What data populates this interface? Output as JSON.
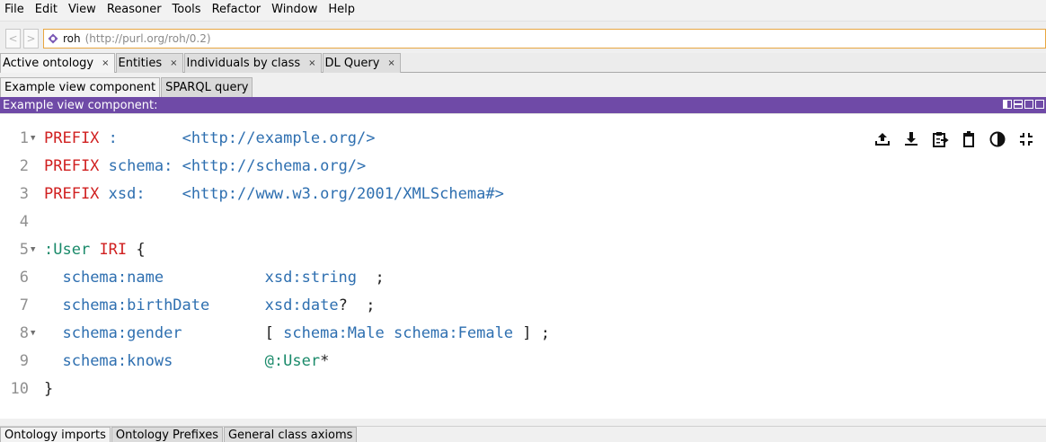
{
  "menu": [
    "File",
    "Edit",
    "View",
    "Reasoner",
    "Tools",
    "Refactor",
    "Window",
    "Help"
  ],
  "nav": {
    "back": "<",
    "forward": ">"
  },
  "iri_bar": {
    "name": "roh",
    "url": "(http://purl.org/roh/0.2)"
  },
  "tabs": [
    {
      "label": "Active ontology",
      "close": "×"
    },
    {
      "label": "Entities",
      "close": "×"
    },
    {
      "label": "Individuals by class",
      "close": "×"
    },
    {
      "label": "DL Query",
      "close": "×"
    }
  ],
  "subtabs": [
    "Example view component",
    "SPARQL query"
  ],
  "view_header": {
    "title": "Example view component:"
  },
  "editor": {
    "lines": [
      {
        "n": "1",
        "fold": "▼",
        "tokens": [
          [
            "kw",
            "PREFIX"
          ],
          [
            "op",
            " "
          ],
          [
            "pfx",
            ":"
          ],
          [
            "op",
            "       "
          ],
          [
            "iri",
            "<http://example.org/>"
          ]
        ]
      },
      {
        "n": "2",
        "fold": "",
        "tokens": [
          [
            "kw",
            "PREFIX"
          ],
          [
            "op",
            " "
          ],
          [
            "pfx",
            "schema:"
          ],
          [
            "op",
            " "
          ],
          [
            "iri",
            "<http://schema.org/>"
          ]
        ]
      },
      {
        "n": "3",
        "fold": "",
        "tokens": [
          [
            "kw",
            "PREFIX"
          ],
          [
            "op",
            " "
          ],
          [
            "pfx",
            "xsd:"
          ],
          [
            "op",
            "    "
          ],
          [
            "iri",
            "<http://www.w3.org/2001/XMLSchema#>"
          ]
        ]
      },
      {
        "n": "4",
        "fold": "",
        "tokens": []
      },
      {
        "n": "5",
        "fold": "▼",
        "tokens": [
          [
            "shape",
            ":User"
          ],
          [
            "op",
            " "
          ],
          [
            "kw",
            "IRI"
          ],
          [
            "op",
            " {"
          ]
        ]
      },
      {
        "n": "6",
        "fold": "",
        "tokens": [
          [
            "op",
            "  "
          ],
          [
            "pfx",
            "schema:name"
          ],
          [
            "op",
            "           "
          ],
          [
            "pfx",
            "xsd:string"
          ],
          [
            "op",
            "  ;"
          ]
        ]
      },
      {
        "n": "7",
        "fold": "",
        "tokens": [
          [
            "op",
            "  "
          ],
          [
            "pfx",
            "schema:birthDate"
          ],
          [
            "op",
            "      "
          ],
          [
            "pfx",
            "xsd:date"
          ],
          [
            "op",
            "?  ;"
          ]
        ]
      },
      {
        "n": "8",
        "fold": "▼",
        "tokens": [
          [
            "op",
            "  "
          ],
          [
            "pfx",
            "schema:gender"
          ],
          [
            "op",
            "         [ "
          ],
          [
            "pfx",
            "schema:Male"
          ],
          [
            "op",
            " "
          ],
          [
            "pfx",
            "schema:Female"
          ],
          [
            "op",
            " ] ;"
          ]
        ]
      },
      {
        "n": "9",
        "fold": "",
        "tokens": [
          [
            "op",
            "  "
          ],
          [
            "pfx",
            "schema:knows"
          ],
          [
            "op",
            "          "
          ],
          [
            "ref",
            "@:User"
          ],
          [
            "op",
            "*"
          ]
        ]
      },
      {
        "n": "10",
        "fold": "",
        "tokens": [
          [
            "op",
            "}"
          ]
        ]
      }
    ]
  },
  "toolbar_icons": [
    "upload-icon",
    "download-icon",
    "clipboard-icon",
    "trash-icon",
    "contrast-icon",
    "collapse-icon"
  ],
  "bottom_tabs": [
    "Ontology imports",
    "Ontology Prefixes",
    "General class axioms"
  ],
  "colors": {
    "header": "#6f4aa7",
    "keyword": "#d02020",
    "prefix": "#2e6fb0",
    "shape": "#1a8a6a",
    "iri_border": "#e8a640"
  }
}
